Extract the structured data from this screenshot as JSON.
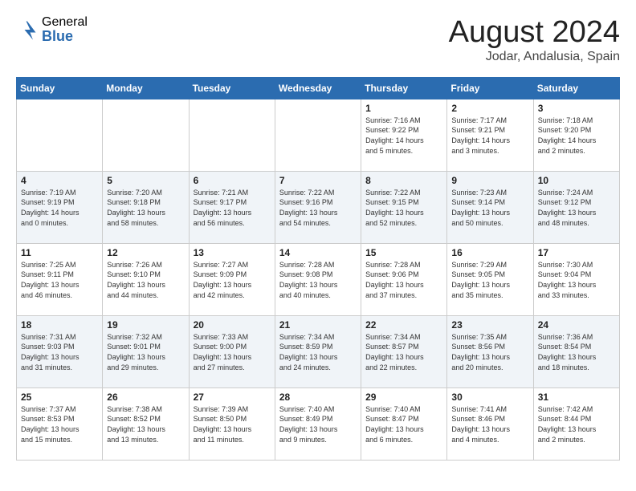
{
  "header": {
    "logo_general": "General",
    "logo_blue": "Blue",
    "month_title": "August 2024",
    "location": "Jodar, Andalusia, Spain"
  },
  "weekdays": [
    "Sunday",
    "Monday",
    "Tuesday",
    "Wednesday",
    "Thursday",
    "Friday",
    "Saturday"
  ],
  "weeks": [
    [
      {
        "day": "",
        "info": ""
      },
      {
        "day": "",
        "info": ""
      },
      {
        "day": "",
        "info": ""
      },
      {
        "day": "",
        "info": ""
      },
      {
        "day": "1",
        "info": "Sunrise: 7:16 AM\nSunset: 9:22 PM\nDaylight: 14 hours\nand 5 minutes."
      },
      {
        "day": "2",
        "info": "Sunrise: 7:17 AM\nSunset: 9:21 PM\nDaylight: 14 hours\nand 3 minutes."
      },
      {
        "day": "3",
        "info": "Sunrise: 7:18 AM\nSunset: 9:20 PM\nDaylight: 14 hours\nand 2 minutes."
      }
    ],
    [
      {
        "day": "4",
        "info": "Sunrise: 7:19 AM\nSunset: 9:19 PM\nDaylight: 14 hours\nand 0 minutes."
      },
      {
        "day": "5",
        "info": "Sunrise: 7:20 AM\nSunset: 9:18 PM\nDaylight: 13 hours\nand 58 minutes."
      },
      {
        "day": "6",
        "info": "Sunrise: 7:21 AM\nSunset: 9:17 PM\nDaylight: 13 hours\nand 56 minutes."
      },
      {
        "day": "7",
        "info": "Sunrise: 7:22 AM\nSunset: 9:16 PM\nDaylight: 13 hours\nand 54 minutes."
      },
      {
        "day": "8",
        "info": "Sunrise: 7:22 AM\nSunset: 9:15 PM\nDaylight: 13 hours\nand 52 minutes."
      },
      {
        "day": "9",
        "info": "Sunrise: 7:23 AM\nSunset: 9:14 PM\nDaylight: 13 hours\nand 50 minutes."
      },
      {
        "day": "10",
        "info": "Sunrise: 7:24 AM\nSunset: 9:12 PM\nDaylight: 13 hours\nand 48 minutes."
      }
    ],
    [
      {
        "day": "11",
        "info": "Sunrise: 7:25 AM\nSunset: 9:11 PM\nDaylight: 13 hours\nand 46 minutes."
      },
      {
        "day": "12",
        "info": "Sunrise: 7:26 AM\nSunset: 9:10 PM\nDaylight: 13 hours\nand 44 minutes."
      },
      {
        "day": "13",
        "info": "Sunrise: 7:27 AM\nSunset: 9:09 PM\nDaylight: 13 hours\nand 42 minutes."
      },
      {
        "day": "14",
        "info": "Sunrise: 7:28 AM\nSunset: 9:08 PM\nDaylight: 13 hours\nand 40 minutes."
      },
      {
        "day": "15",
        "info": "Sunrise: 7:28 AM\nSunset: 9:06 PM\nDaylight: 13 hours\nand 37 minutes."
      },
      {
        "day": "16",
        "info": "Sunrise: 7:29 AM\nSunset: 9:05 PM\nDaylight: 13 hours\nand 35 minutes."
      },
      {
        "day": "17",
        "info": "Sunrise: 7:30 AM\nSunset: 9:04 PM\nDaylight: 13 hours\nand 33 minutes."
      }
    ],
    [
      {
        "day": "18",
        "info": "Sunrise: 7:31 AM\nSunset: 9:03 PM\nDaylight: 13 hours\nand 31 minutes."
      },
      {
        "day": "19",
        "info": "Sunrise: 7:32 AM\nSunset: 9:01 PM\nDaylight: 13 hours\nand 29 minutes."
      },
      {
        "day": "20",
        "info": "Sunrise: 7:33 AM\nSunset: 9:00 PM\nDaylight: 13 hours\nand 27 minutes."
      },
      {
        "day": "21",
        "info": "Sunrise: 7:34 AM\nSunset: 8:59 PM\nDaylight: 13 hours\nand 24 minutes."
      },
      {
        "day": "22",
        "info": "Sunrise: 7:34 AM\nSunset: 8:57 PM\nDaylight: 13 hours\nand 22 minutes."
      },
      {
        "day": "23",
        "info": "Sunrise: 7:35 AM\nSunset: 8:56 PM\nDaylight: 13 hours\nand 20 minutes."
      },
      {
        "day": "24",
        "info": "Sunrise: 7:36 AM\nSunset: 8:54 PM\nDaylight: 13 hours\nand 18 minutes."
      }
    ],
    [
      {
        "day": "25",
        "info": "Sunrise: 7:37 AM\nSunset: 8:53 PM\nDaylight: 13 hours\nand 15 minutes."
      },
      {
        "day": "26",
        "info": "Sunrise: 7:38 AM\nSunset: 8:52 PM\nDaylight: 13 hours\nand 13 minutes."
      },
      {
        "day": "27",
        "info": "Sunrise: 7:39 AM\nSunset: 8:50 PM\nDaylight: 13 hours\nand 11 minutes."
      },
      {
        "day": "28",
        "info": "Sunrise: 7:40 AM\nSunset: 8:49 PM\nDaylight: 13 hours\nand 9 minutes."
      },
      {
        "day": "29",
        "info": "Sunrise: 7:40 AM\nSunset: 8:47 PM\nDaylight: 13 hours\nand 6 minutes."
      },
      {
        "day": "30",
        "info": "Sunrise: 7:41 AM\nSunset: 8:46 PM\nDaylight: 13 hours\nand 4 minutes."
      },
      {
        "day": "31",
        "info": "Sunrise: 7:42 AM\nSunset: 8:44 PM\nDaylight: 13 hours\nand 2 minutes."
      }
    ]
  ]
}
